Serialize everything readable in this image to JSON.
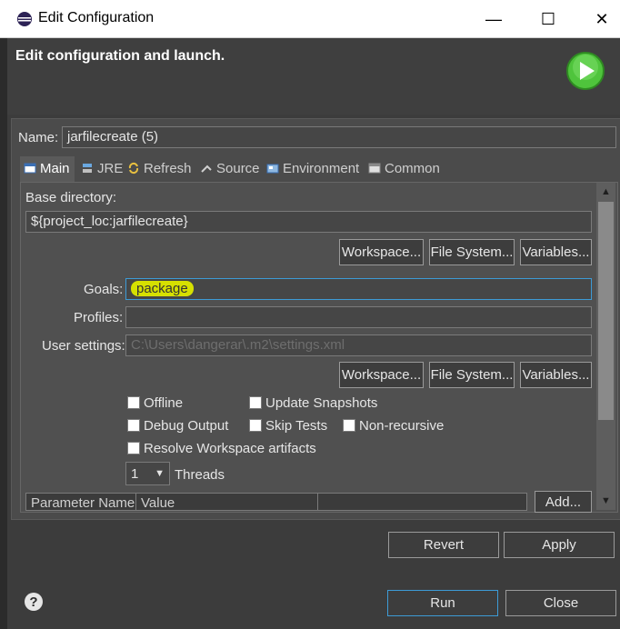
{
  "window": {
    "title": "Edit Configuration",
    "minimize_glyph": "—",
    "maximize_glyph": "☐",
    "close_glyph": "✕"
  },
  "header": {
    "title": "Edit configuration and launch."
  },
  "name_field": {
    "label": "Name:",
    "value": "jarfilecreate (5)"
  },
  "tabs": [
    {
      "label": "Main",
      "icon": "main-tab-icon",
      "active": true
    },
    {
      "label": "JRE",
      "icon": "jre-icon",
      "active": false
    },
    {
      "label": "Refresh",
      "icon": "refresh-icon",
      "active": false
    },
    {
      "label": "Source",
      "icon": "source-icon",
      "active": false
    },
    {
      "label": "Environment",
      "icon": "environment-icon",
      "active": false
    },
    {
      "label": "Common",
      "icon": "common-icon",
      "active": false
    }
  ],
  "base_directory": {
    "label": "Base directory:",
    "value": "${project_loc:jarfilecreate}",
    "buttons": {
      "workspace": "Workspace...",
      "file_system": "File System...",
      "variables": "Variables..."
    }
  },
  "goals": {
    "label": "Goals:",
    "value": "package"
  },
  "profiles": {
    "label": "Profiles:",
    "value": ""
  },
  "user_settings": {
    "label": "User settings:",
    "value": "C:\\Users\\dangerar\\.m2\\settings.xml",
    "buttons": {
      "workspace": "Workspace...",
      "file_system": "File System...",
      "variables": "Variables..."
    }
  },
  "options": {
    "offline": "Offline",
    "update_snapshots": "Update Snapshots",
    "debug_output": "Debug Output",
    "skip_tests": "Skip Tests",
    "non_recursive": "Non-recursive",
    "resolve_workspace": "Resolve Workspace artifacts"
  },
  "threads": {
    "value": "1",
    "label": "Threads"
  },
  "parameters": {
    "columns": [
      "Parameter Name",
      "Value"
    ],
    "add_button": "Add..."
  },
  "footer": {
    "revert": "Revert",
    "apply": "Apply",
    "run": "Run",
    "close": "Close"
  },
  "colors": {
    "accent": "#3d9bd6",
    "goal_highlight": "#d6e000",
    "launch_icon": "#4fc43c"
  }
}
